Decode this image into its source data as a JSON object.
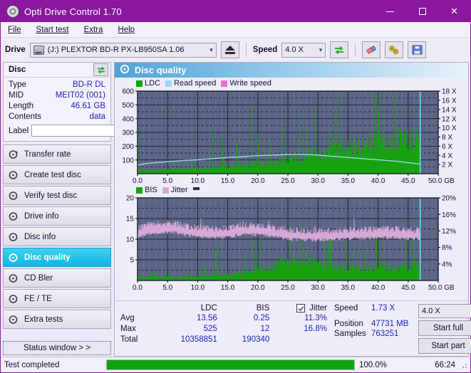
{
  "window": {
    "title": "Opti Drive Control 1.70",
    "icon": "disc-icon",
    "minimize": "minimize-icon",
    "maximize": "maximize-icon",
    "close": "close-icon"
  },
  "menu": [
    {
      "label": "File",
      "accel": "F"
    },
    {
      "label": "Start test",
      "accel": "S"
    },
    {
      "label": "Extra",
      "accel": "x"
    },
    {
      "label": "Help",
      "accel": "H"
    }
  ],
  "toolbar": {
    "drive_label": "Drive",
    "drive_value": "(J:)  PLEXTOR BD-R  PX-LB950SA 1.06",
    "eject": "eject-icon",
    "speed_label": "Speed",
    "speed_value": "4.0 X",
    "refresh": "refresh-icon",
    "erase": "eraser-icon",
    "tools": "tools-icon",
    "save": "save-icon"
  },
  "disc": {
    "panel_title": "Disc",
    "refresh": "refresh-icon",
    "rows": [
      {
        "key": "Type",
        "value": "BD-R DL"
      },
      {
        "key": "MID",
        "value": "MEIT02 (001)"
      },
      {
        "key": "Length",
        "value": "46.61 GB"
      },
      {
        "key": "Contents",
        "value": "data"
      }
    ],
    "label_key": "Label",
    "label_value": "",
    "label_placeholder": ""
  },
  "nav": {
    "items": [
      {
        "label": "Transfer rate",
        "active": false
      },
      {
        "label": "Create test disc",
        "active": false
      },
      {
        "label": "Verify test disc",
        "active": false
      },
      {
        "label": "Drive info",
        "active": false
      },
      {
        "label": "Disc info",
        "active": false
      },
      {
        "label": "Disc quality",
        "active": true
      },
      {
        "label": "CD Bler",
        "active": false
      },
      {
        "label": "FE / TE",
        "active": false
      },
      {
        "label": "Extra tests",
        "active": false
      }
    ],
    "status_window": "Status window > >"
  },
  "panel": {
    "title": "Disc quality",
    "icon": "disc-quality-icon"
  },
  "stats": {
    "columns": [
      "LDC",
      "BIS"
    ],
    "jitter_label": "Jitter",
    "jitter_checked": true,
    "rows": [
      {
        "name": "Avg",
        "ldc": "13.56",
        "bis": "0.25",
        "jitter": "11.3%"
      },
      {
        "name": "Max",
        "ldc": "525",
        "bis": "12",
        "jitter": "16.8%"
      },
      {
        "name": "Total",
        "ldc": "10358851",
        "bis": "190340",
        "jitter": ""
      }
    ],
    "speed_key": "Speed",
    "speed_value": "1.73 X",
    "position_key": "Position",
    "position_value": "47731 MB",
    "samples_key": "Samples",
    "samples_value": "763251",
    "speed_select": "4.0 X",
    "start_full": "Start full",
    "start_part": "Start part"
  },
  "statusbar": {
    "message": "Test completed",
    "progress_percent": 100.0,
    "progress_text": "100.0%",
    "elapsed": "66:24"
  },
  "colors": {
    "accent_purple": "#8a179e",
    "ldc_green": "#16a30f",
    "read_speed_blue": "#9fd9f2",
    "write_speed_pink": "#f26fd0",
    "bis_green": "#16a30f",
    "jitter_pink": "#d7a8d7",
    "plot_bg": "#5b6584",
    "value_blue": "#1c24c8",
    "progress_green": "#13a312"
  },
  "chart_data": [
    {
      "type": "line",
      "title": "Disc quality - LDC / Read speed",
      "xlabel": "GB",
      "ylabel": "LDC",
      "y2label": "X",
      "xlim": [
        0.0,
        50.0
      ],
      "ylim": [
        0,
        600
      ],
      "y2lim": [
        0,
        18
      ],
      "grid": true,
      "legend_position": "top-left",
      "xticks": [
        "0.0",
        "5.0",
        "10.0",
        "15.0",
        "20.0",
        "25.0",
        "30.0",
        "35.0",
        "40.0",
        "45.0",
        "50.0 GB"
      ],
      "yticks": [
        "100",
        "200",
        "300",
        "400",
        "500",
        "600"
      ],
      "y2ticks": [
        "2 X",
        "4 X",
        "6 X",
        "8 X",
        "10 X",
        "12 X",
        "14 X",
        "16 X",
        "18 X"
      ],
      "legend": [
        {
          "name": "LDC",
          "color": "#16a30f"
        },
        {
          "name": "Read speed",
          "color": "#9fd9f2"
        },
        {
          "name": "Write speed",
          "color": "#f26fd0"
        }
      ],
      "series": [
        {
          "name": "LDC",
          "kind": "impulse-envelope",
          "data_end_x": 47.0,
          "baseline": [
            30,
            28,
            26,
            30,
            34,
            32,
            30,
            34,
            38,
            40,
            42,
            46,
            48,
            52,
            56,
            58,
            62,
            66,
            70,
            74,
            80,
            86,
            92,
            100,
            108,
            118,
            128,
            138,
            150,
            162,
            175,
            188,
            200,
            212,
            222,
            230,
            236,
            240,
            244,
            248,
            252,
            256,
            258,
            262,
            266,
            268,
            270
          ],
          "spike_max": 525
        },
        {
          "name": "Read speed",
          "kind": "line",
          "axis": "y2",
          "x": [
            0,
            2,
            4,
            6,
            8,
            10,
            12,
            14,
            16,
            18,
            20,
            22,
            24,
            26,
            28,
            30,
            32,
            34,
            36,
            38,
            40,
            42,
            44,
            46,
            47
          ],
          "values": [
            1.9,
            2.3,
            2.5,
            2.7,
            2.9,
            3.0,
            3.2,
            3.4,
            3.6,
            3.7,
            3.9,
            4.0,
            4.1,
            4.2,
            4.2,
            4.1,
            3.9,
            3.7,
            3.5,
            3.3,
            3.1,
            2.9,
            2.7,
            2.4,
            2.1
          ]
        },
        {
          "name": "Write speed",
          "kind": "line",
          "axis": "y2",
          "x": [],
          "values": []
        }
      ],
      "cursor_x": 47.0
    },
    {
      "type": "line",
      "title": "Disc quality - BIS / Jitter",
      "xlabel": "GB",
      "ylabel": "BIS",
      "y2label": "%",
      "xlim": [
        0.0,
        50.0
      ],
      "ylim": [
        0,
        20
      ],
      "y2lim": [
        0,
        20
      ],
      "grid": true,
      "legend_position": "top-left",
      "xticks": [
        "0.0",
        "5.0",
        "10.0",
        "15.0",
        "20.0",
        "25.0",
        "30.0",
        "35.0",
        "40.0",
        "45.0",
        "50.0 GB"
      ],
      "yticks": [
        "5",
        "10",
        "15",
        "20"
      ],
      "y2ticks": [
        "4%",
        "8%",
        "12%",
        "16%",
        "20%"
      ],
      "legend": [
        {
          "name": "BIS",
          "color": "#16a30f"
        },
        {
          "name": "Jitter",
          "color": "#d7a8d7"
        }
      ],
      "series": [
        {
          "name": "BIS",
          "kind": "impulse-envelope",
          "data_end_x": 47.0,
          "baseline": [
            1.0,
            0.9,
            0.8,
            0.9,
            1.0,
            0.9,
            0.8,
            0.9,
            1.0,
            1.1,
            1.0,
            1.1,
            1.2,
            1.3,
            1.4,
            1.6,
            1.8,
            2.0,
            2.3,
            2.6,
            3.0,
            3.4,
            3.8,
            4.3,
            4.6,
            4.8,
            4.9,
            5.0,
            4.8,
            4.5,
            4.0,
            3.6,
            3.4,
            3.3,
            3.2,
            3.2,
            3.2,
            3.3,
            3.4,
            3.5,
            3.6,
            3.7,
            3.8,
            3.9,
            4.0,
            4.1,
            4.2
          ],
          "spike_max": 12
        },
        {
          "name": "Jitter",
          "kind": "band",
          "axis": "y2",
          "x": [
            0,
            2,
            4,
            6,
            8,
            10,
            12,
            14,
            16,
            18,
            20,
            22,
            24,
            26,
            28,
            30,
            32,
            34,
            36,
            38,
            40,
            42,
            44,
            46,
            47
          ],
          "values": [
            11.3,
            12.2,
            12.4,
            12.6,
            12.0,
            11.6,
            11.4,
            11.2,
            11.6,
            12.2,
            12.0,
            11.8,
            11.3,
            10.9,
            10.8,
            10.7,
            10.8,
            10.9,
            11.0,
            11.1,
            11.2,
            11.3,
            11.2,
            11.0,
            10.9
          ],
          "max": 16.8
        }
      ],
      "cursor_x": 47.0
    }
  ]
}
